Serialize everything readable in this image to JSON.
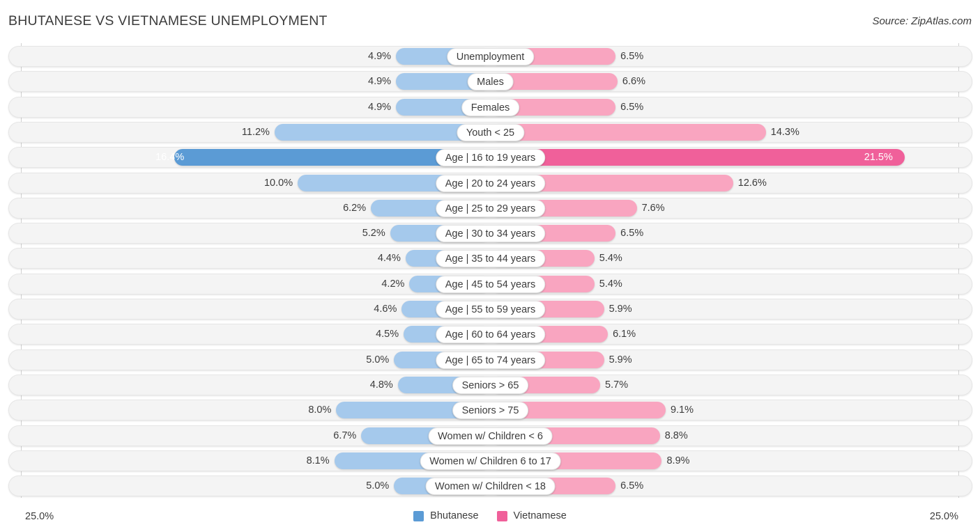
{
  "header": {
    "title": "BHUTANESE VS VIETNAMESE UNEMPLOYMENT",
    "source": "Source: ZipAtlas.com"
  },
  "legend": {
    "left": {
      "label": "Bhutanese",
      "color": "#5b9bd5"
    },
    "right": {
      "label": "Vietnamese",
      "color": "#f0609a"
    }
  },
  "axis": {
    "max_left_label": "25.0%",
    "max_right_label": "25.0%",
    "max_value": 25.0
  },
  "colors": {
    "bar_left": "#a5c9ec",
    "bar_right": "#f9a5c0",
    "bar_left_peak": "#5b9bd5",
    "bar_right_peak": "#f0609a",
    "track": "#f4f4f4",
    "text": "#3c3c3c"
  },
  "chart_data": {
    "type": "bar",
    "subtype": "diverging-horizontal-bar",
    "title": "BHUTANESE VS VIETNAMESE UNEMPLOYMENT",
    "xlabel": "",
    "ylabel": "",
    "xlim": [
      -25.0,
      25.0
    ],
    "grid": false,
    "legend_position": "bottom-center",
    "categories": [
      "Unemployment",
      "Males",
      "Females",
      "Youth < 25",
      "Age | 16 to 19 years",
      "Age | 20 to 24 years",
      "Age | 25 to 29 years",
      "Age | 30 to 34 years",
      "Age | 35 to 44 years",
      "Age | 45 to 54 years",
      "Age | 55 to 59 years",
      "Age | 60 to 64 years",
      "Age | 65 to 74 years",
      "Seniors > 65",
      "Seniors > 75",
      "Women w/ Children < 6",
      "Women w/ Children 6 to 17",
      "Women w/ Children < 18"
    ],
    "series": [
      {
        "name": "Bhutanese",
        "color": "#5b9bd5",
        "values": [
          4.9,
          4.9,
          4.9,
          11.2,
          16.4,
          10.0,
          6.2,
          5.2,
          4.4,
          4.2,
          4.6,
          4.5,
          5.0,
          4.8,
          8.0,
          6.7,
          8.1,
          5.0
        ],
        "labels": [
          "4.9%",
          "4.9%",
          "4.9%",
          "11.2%",
          "16.4%",
          "10.0%",
          "6.2%",
          "5.2%",
          "4.4%",
          "4.2%",
          "4.6%",
          "4.5%",
          "5.0%",
          "4.8%",
          "8.0%",
          "6.7%",
          "8.1%",
          "5.0%"
        ]
      },
      {
        "name": "Vietnamese",
        "color": "#f0609a",
        "values": [
          6.5,
          6.6,
          6.5,
          14.3,
          21.5,
          12.6,
          7.6,
          6.5,
          5.4,
          5.4,
          5.9,
          6.1,
          5.9,
          5.7,
          9.1,
          8.8,
          8.9,
          6.5
        ],
        "labels": [
          "6.5%",
          "6.6%",
          "6.5%",
          "14.3%",
          "21.5%",
          "12.6%",
          "7.6%",
          "6.5%",
          "5.4%",
          "5.4%",
          "5.9%",
          "6.1%",
          "5.9%",
          "5.7%",
          "9.1%",
          "8.8%",
          "8.9%",
          "6.5%"
        ]
      }
    ],
    "highlighted_row_index": 4
  }
}
